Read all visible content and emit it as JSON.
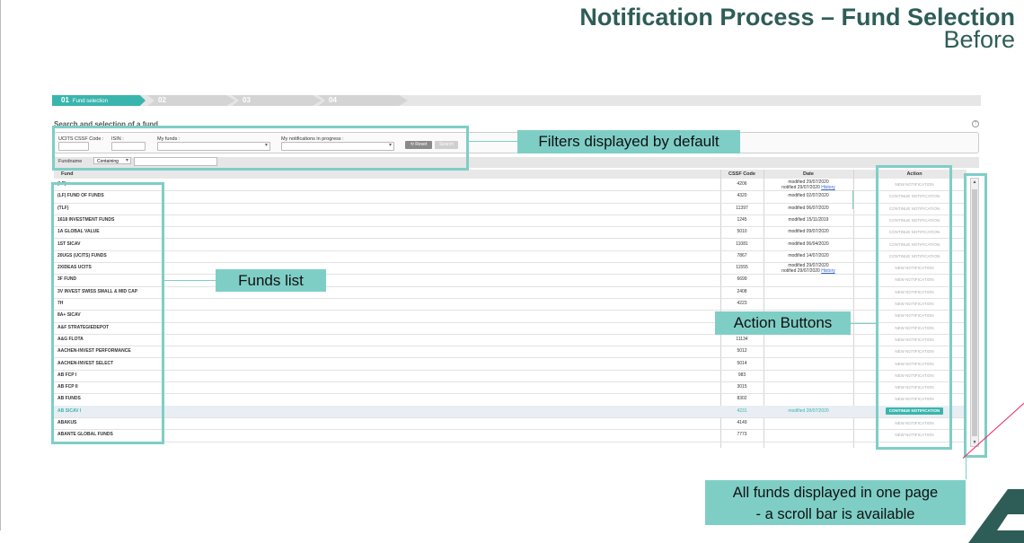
{
  "slide": {
    "title_line1": "Notification Process – Fund Selection",
    "title_line2": "Before"
  },
  "stepper": {
    "steps": [
      {
        "num": "01",
        "label": "Fund selection",
        "active": true
      },
      {
        "num": "02",
        "label": "",
        "active": false
      },
      {
        "num": "03",
        "label": "",
        "active": false
      },
      {
        "num": "04",
        "label": "",
        "active": false
      }
    ]
  },
  "search": {
    "section_title": "Search and selection of a fund",
    "ucits_label": "UCITS CSSF Code :",
    "isin_label": "ISIN :",
    "my_funds_label": "My funds :",
    "in_progress_label": "My notifications in progress :",
    "reset_label": "Reset",
    "search_label": "Search",
    "fundname_label": "Fundname",
    "containing_value": "Containing"
  },
  "table": {
    "headers": {
      "fund": "Fund",
      "code": "CSSF Code",
      "date": "Date",
      "action": "Action"
    },
    "rows": [
      {
        "fund": "(LF)",
        "code": "4206",
        "date1": "modified 29/07/2020",
        "date2": "notified 29/07/2020",
        "history": "History",
        "action": "NEW NOTIFICATION",
        "selected": false
      },
      {
        "fund": "(LF) FUND OF FUNDS",
        "code": "4320",
        "date1": "modified 02/07/2020",
        "date2": "",
        "history": "",
        "action": "CONTINUE NOTIFICATION",
        "selected": false
      },
      {
        "fund": "(TLF)",
        "code": "11397",
        "date1": "modified 06/07/2020",
        "date2": "",
        "history": "",
        "action": "CONTINUE NOTIFICATION",
        "selected": false
      },
      {
        "fund": "1618 INVESTMENT FUNDS",
        "code": "1245",
        "date1": "modified 15/11/2019",
        "date2": "",
        "history": "",
        "action": "CONTINUE NOTIFICATION",
        "selected": false
      },
      {
        "fund": "1A GLOBAL VALUE",
        "code": "5010",
        "date1": "modified 09/07/2020",
        "date2": "",
        "history": "",
        "action": "CONTINUE NOTIFICATION",
        "selected": false
      },
      {
        "fund": "1ST SICAV",
        "code": "11081",
        "date1": "modified 06/04/2020",
        "date2": "",
        "history": "",
        "action": "CONTINUE NOTIFICATION",
        "selected": false
      },
      {
        "fund": "20UGS (UCITS) FUNDS",
        "code": "7867",
        "date1": "modified 14/07/2020",
        "date2": "",
        "history": "",
        "action": "CONTINUE NOTIFICATION",
        "selected": false
      },
      {
        "fund": "2XIDEAS UCITS",
        "code": "11555",
        "date1": "modified 29/07/2020",
        "date2": "notified 29/07/2020",
        "history": "History",
        "action": "NEW NOTIFICATION",
        "selected": false
      },
      {
        "fund": "3F FUND",
        "code": "6699",
        "date1": "",
        "date2": "",
        "history": "",
        "action": "NEW NOTIFICATION",
        "selected": false
      },
      {
        "fund": "3V INVEST SWISS SMALL & MID CAP",
        "code": "2408",
        "date1": "",
        "date2": "",
        "history": "",
        "action": "NEW NOTIFICATION",
        "selected": false
      },
      {
        "fund": "7H",
        "code": "4223",
        "date1": "",
        "date2": "",
        "history": "",
        "action": "NEW NOTIFICATION",
        "selected": false
      },
      {
        "fund": "8A+ SICAV",
        "code": "",
        "date1": "",
        "date2": "",
        "history": "",
        "action": "NEW NOTIFICATION",
        "selected": false
      },
      {
        "fund": "A&F STRATEGIEDEPOT",
        "code": "",
        "date1": "",
        "date2": "",
        "history": "",
        "action": "NEW NOTIFICATION",
        "selected": false
      },
      {
        "fund": "A&G FLOTA",
        "code": "11134",
        "date1": "",
        "date2": "",
        "history": "",
        "action": "NEW NOTIFICATION",
        "selected": false
      },
      {
        "fund": "AACHEN-INVEST PERFORMANCE",
        "code": "5012",
        "date1": "",
        "date2": "",
        "history": "",
        "action": "NEW NOTIFICATION",
        "selected": false
      },
      {
        "fund": "AACHEN-INVEST SELECT",
        "code": "5014",
        "date1": "",
        "date2": "",
        "history": "",
        "action": "NEW NOTIFICATION",
        "selected": false
      },
      {
        "fund": "AB FCP I",
        "code": "983",
        "date1": "",
        "date2": "",
        "history": "",
        "action": "NEW NOTIFICATION",
        "selected": false
      },
      {
        "fund": "AB FCP II",
        "code": "3015",
        "date1": "",
        "date2": "",
        "history": "",
        "action": "NEW NOTIFICATION",
        "selected": false
      },
      {
        "fund": "AB FUNDS",
        "code": "8302",
        "date1": "",
        "date2": "",
        "history": "",
        "action": "NEW NOTIFICATION",
        "selected": false
      },
      {
        "fund": "AB SICAV I",
        "code": "4231",
        "date1": "modified 28/07/2020",
        "date2": "",
        "history": "",
        "action": "CONTINUE NOTIFICATION",
        "selected": true
      },
      {
        "fund": "ABAKUS",
        "code": "4149",
        "date1": "",
        "date2": "",
        "history": "",
        "action": "NEW NOTIFICATION",
        "selected": false
      },
      {
        "fund": "ABANTE GLOBAL FUNDS",
        "code": "7773",
        "date1": "",
        "date2": "",
        "history": "",
        "action": "NEW NOTIFICATION",
        "selected": false
      }
    ]
  },
  "annotations": {
    "filters": "Filters displayed by default",
    "funds_list": "Funds list",
    "action_buttons": "Action Buttons",
    "scroll_line1": "All funds displayed in one page",
    "scroll_line2": "- a scroll bar is available"
  },
  "colors": {
    "accent": "#3ab5ad",
    "highlight": "#7ecec6",
    "title": "#2e5d57"
  }
}
